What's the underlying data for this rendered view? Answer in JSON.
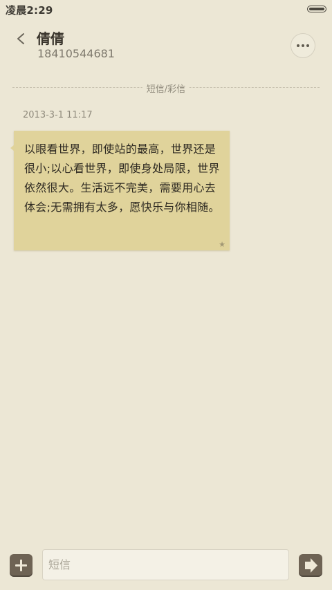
{
  "status_bar": {
    "time": "凌晨2:29",
    "battery_level": 1.0,
    "battery_icon": "battery-icon"
  },
  "header": {
    "back_icon": "chevron-left-icon",
    "contact_name": "倩倩",
    "contact_phone": "18410544681",
    "more_icon": "more-dots-icon"
  },
  "conversation": {
    "divider_label": "短信/彩信",
    "messages": [
      {
        "timestamp": "2013-3-1 11:17",
        "text": "以眼看世界，即使站的最高，世界还是很小;以心看世界，即使身处局限，世界依然很大。生活远不完美，需要用心去体会;无需拥有太多，愿快乐与你相随。",
        "star_icon": "star-icon",
        "bubble_color": "#e0d39b"
      }
    ]
  },
  "composer": {
    "attach_icon": "plus-icon",
    "input_value": "",
    "input_placeholder": "短信",
    "send_icon": "send-arrow-icon"
  },
  "colors": {
    "background": "#ece7d5",
    "button_brown": "#6e6354",
    "bubble": "#e0d39b"
  }
}
